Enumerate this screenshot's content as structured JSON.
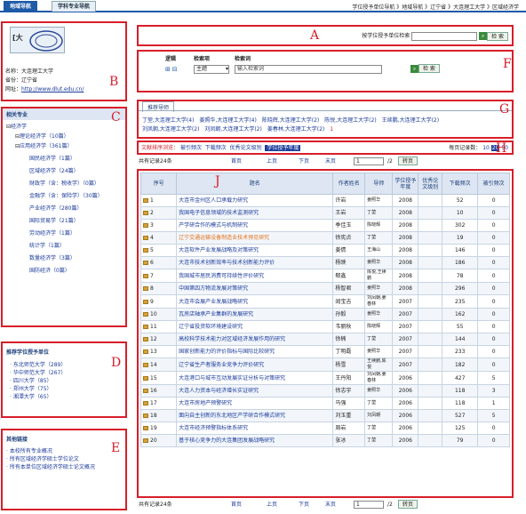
{
  "tabs": [
    {
      "label": "地域导航"
    },
    {
      "label": "学科专业导航"
    }
  ],
  "breadcrumb": "学位授予单位导航 》地域导航 》辽宁省 》大连理工大学 》区域经济学",
  "univ": {
    "name_label": "名称：",
    "name": "大连理工大学",
    "province_label": "省份：",
    "province": "辽宁省",
    "url_label": "网址：",
    "url": "http://www.dlut.edu.cn/",
    "logo_text": "[大"
  },
  "labels": {
    "A": "A",
    "B": "B",
    "C": "C",
    "D": "D",
    "E": "E",
    "F": "F",
    "G": "G",
    "H": "H",
    "J": "J"
  },
  "search_a": {
    "label": "按学位授予单位检索",
    "button": "检 索"
  },
  "search_f": {
    "logic_label": "逻辑",
    "field_label": "检索项",
    "term_label": "检索词",
    "field_value": "主题",
    "term_placeholder": "输入检索词",
    "button": "检 索"
  },
  "subjects": {
    "title": "相关专业",
    "root": "经济学",
    "items": [
      {
        "text": "理论经济学（10篇）",
        "level": 1
      },
      {
        "text": "应用经济学（361篇）",
        "level": 1
      },
      {
        "text": "国民经济学（1篇）",
        "level": 2
      },
      {
        "text": "区域经济学（24篇）",
        "level": 2
      },
      {
        "text": "财政学（含：税收学）（0篇）",
        "level": 2
      },
      {
        "text": "金融学（含：保险学）（30篇）",
        "level": 2
      },
      {
        "text": "产业经济学（280篇）",
        "level": 2
      },
      {
        "text": "国际贸易学（21篇）",
        "level": 2
      },
      {
        "text": "劳动经济学（1篇）",
        "level": 2
      },
      {
        "text": "统计学（1篇）",
        "level": 2
      },
      {
        "text": "数量经济学（3篇）",
        "level": 2
      },
      {
        "text": "国防经济（0篇）",
        "level": 2
      }
    ]
  },
  "units": {
    "title": "推荐学位授予单位",
    "items": [
      "东北师范大学（289）",
      "华中师范大学（267）",
      "四川大学（85）",
      "郑州大学（75）",
      "湘潭大学（65）"
    ]
  },
  "links": {
    "title": "其他链接",
    "items": [
      "本校所有专业概况",
      "所有区域经济学硕士学位论文",
      "所有本单位区域经济学硕士论文概况"
    ]
  },
  "advisors": {
    "tab": "推荐导师",
    "row1": [
      "丁堃,大连理工大学(4)",
      "姜照华,大连理工大学(4)",
      "陈晓辉,大连理工大学(2)",
      "陈悦,大连理工大学(2)",
      "王续鹏,大连理工大学(2)"
    ],
    "row2": [
      "刘凤朝,大连理工大学(2)",
      "刘凤朝,大连理工大学(2)",
      "姜春林,大连理工大学(2)"
    ],
    "page": "1"
  },
  "sort": {
    "label": "文献排序浏览：",
    "options": [
      "被引频次",
      "下载频次",
      "优秀论文级别"
    ],
    "active": "学位授予年度",
    "per_page_label": "每页记录数：",
    "sizes": [
      "10",
      "20",
      "50"
    ],
    "active_size": "20"
  },
  "pager": {
    "total": "共有记录24条",
    "first": "首页",
    "prev": "上页",
    "next": "下页",
    "last": "末页",
    "page": "1",
    "of": "/2",
    "go": "转页"
  },
  "table": {
    "headers": [
      "序号",
      "题名",
      "作者姓名",
      "导师",
      "学位授予年度",
      "优秀论文级别",
      "下载频次",
      "被引频次"
    ],
    "rows": [
      [
        "1",
        "大连市金州区人口承载力研究",
        "许岩",
        "姜照华",
        "2008",
        "",
        "52",
        "0"
      ],
      [
        "2",
        "我国电子信息领域的技术监测研究",
        "王岩",
        "丁堃",
        "2008",
        "",
        "10",
        "0"
      ],
      [
        "3",
        "产学研合作的模式与机制研究",
        "季佳玉",
        "陈晓辉",
        "2008",
        "",
        "302",
        "0"
      ],
      [
        "4",
        "辽宁交通运输设备制造业技术预见研究",
        "徐宪贞",
        "丁堃",
        "2008",
        "",
        "19",
        "0"
      ],
      [
        "5",
        "大连软件产业发展战略及对策研究",
        "姜倩",
        "王海山",
        "2008",
        "",
        "146",
        "0"
      ],
      [
        "6",
        "大连市技术创新效率与技术创新能力评价",
        "杨映",
        "姜照华",
        "2008",
        "",
        "186",
        "0"
      ],
      [
        "7",
        "我国城市居民消费可持续性评价研究",
        "郗鑫",
        "陈悦,王续鹏",
        "2008",
        "",
        "78",
        "0"
      ],
      [
        "8",
        "中国第四方物流发展对策研究",
        "杨智君",
        "姜照华",
        "2008",
        "",
        "296",
        "0"
      ],
      [
        "9",
        "大连市会展产业发展战略研究",
        "阎宝吉",
        "刘凤朝,姜春林",
        "2007",
        "",
        "235",
        "0"
      ],
      [
        "10",
        "瓦房店轴承产业集群的发展研究",
        "孙毅",
        "姜照华",
        "2007",
        "",
        "162",
        "0"
      ],
      [
        "11",
        "辽宁省投资软环境建设研究",
        "韦丽秋",
        "陈晓辉",
        "2007",
        "",
        "55",
        "0"
      ],
      [
        "12",
        "高校科学技术能力对区域经济发展作用的研究",
        "徐楠",
        "丁堃",
        "2007",
        "",
        "144",
        "0"
      ],
      [
        "13",
        "国家创新能力的评价指标与国际比较研究",
        "丁明磊",
        "姜照华",
        "2007",
        "",
        "233",
        "0"
      ],
      [
        "14",
        "辽宁省生产者服务业竞争力评价研究",
        "杨雪",
        "王续鹏,陈悦",
        "2007",
        "",
        "182",
        "0"
      ],
      [
        "15",
        "大连港口与城市互动发展实证分析与对策研究",
        "王丹阳",
        "刘凤朝,姜春林",
        "2006",
        "",
        "427",
        "5"
      ],
      [
        "16",
        "大连人力资本与经济增长实证研究",
        "徐志宇",
        "姜照华",
        "2006",
        "",
        "118",
        "3"
      ],
      [
        "17",
        "大连市房地产预警研究",
        "马强",
        "丁堃",
        "2006",
        "",
        "118",
        "1"
      ],
      [
        "18",
        "面向自主创新的东北地区产学研合作模式研究",
        "刘玉重",
        "刘凤朝",
        "2006",
        "",
        "527",
        "5"
      ],
      [
        "19",
        "大连市经济预警指标体系研究",
        "周岩",
        "丁堃",
        "2006",
        "",
        "125",
        "0"
      ],
      [
        "20",
        "基于核心竞争力的大连集团发展战略研究",
        "张冰",
        "丁堃",
        "2006",
        "",
        "79",
        "0"
      ]
    ]
  }
}
